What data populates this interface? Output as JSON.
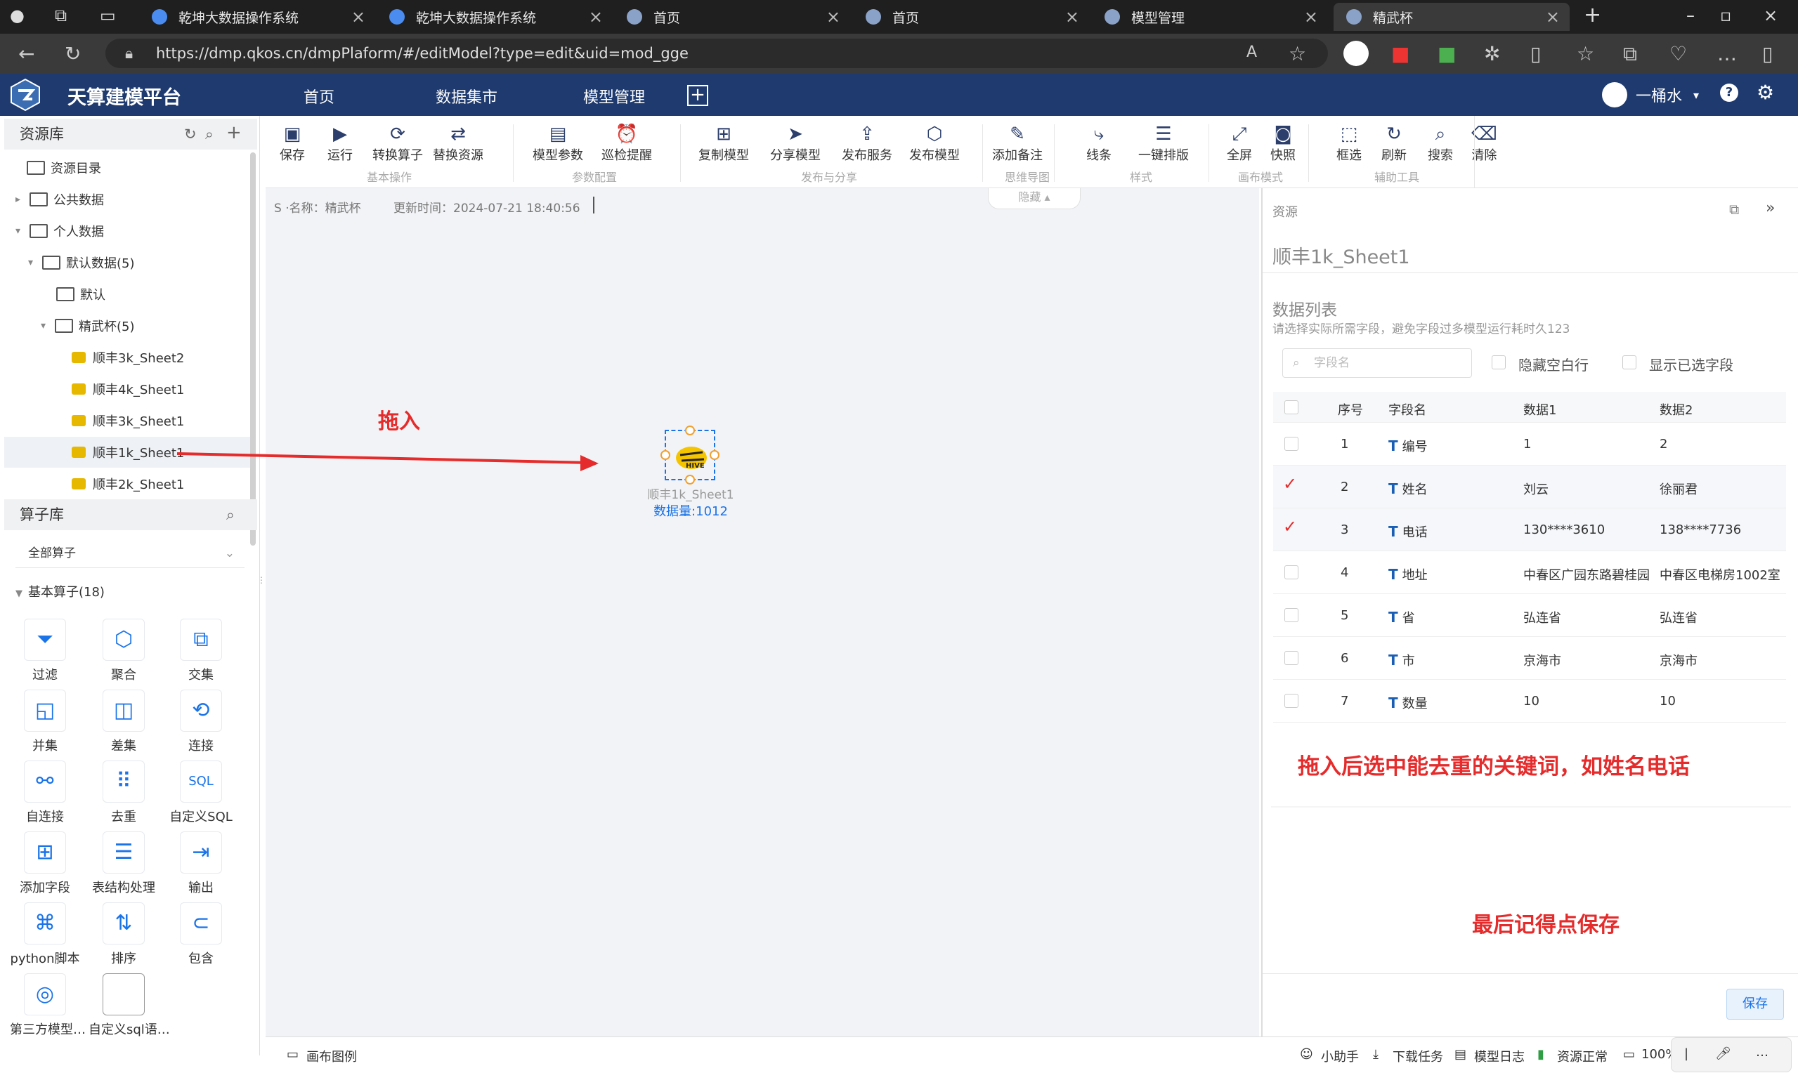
{
  "browser": {
    "tabs": [
      {
        "title": "乾坤大数据操作系统"
      },
      {
        "title": "乾坤大数据操作系统"
      },
      {
        "title": "首页"
      },
      {
        "title": "首页"
      },
      {
        "title": "模型管理"
      },
      {
        "title": "精武杯"
      }
    ],
    "url": "https://dmp.qkos.cn/dmpPlaform/#/editModel?type=edit&uid=mod_gge"
  },
  "app": {
    "name": "天算建模平台",
    "nav": [
      "首页",
      "数据集市",
      "模型管理"
    ],
    "user": "一桶水"
  },
  "left": {
    "resource_title": "资源库",
    "tree": [
      {
        "label": "资源目录",
        "type": "folder"
      },
      {
        "label": "公共数据",
        "type": "folder"
      },
      {
        "label": "个人数据",
        "type": "folder"
      },
      {
        "label": "默认数据(5)",
        "type": "folder"
      },
      {
        "label": "默认",
        "type": "folder"
      },
      {
        "label": "精武杯(5)",
        "type": "folder"
      },
      {
        "label": "顺丰3k_Sheet2",
        "type": "hive"
      },
      {
        "label": "顺丰4k_Sheet1",
        "type": "hive"
      },
      {
        "label": "顺丰3k_Sheet1",
        "type": "hive"
      },
      {
        "label": "顺丰1k_Sheet1",
        "type": "hive"
      },
      {
        "label": "顺丰2k_Sheet1",
        "type": "hive"
      }
    ],
    "operator_title": "算子库",
    "operator_filter": "全部算子",
    "basic_group": "基本算子(18)",
    "operators": [
      "过滤",
      "聚合",
      "交集",
      "并集",
      "差集",
      "连接",
      "自连接",
      "去重",
      "自定义SQL",
      "添加字段",
      "表结构处理",
      "输出",
      "python脚本",
      "排序",
      "包含",
      "第三方模型…",
      "自定义sql语…"
    ]
  },
  "toolbar": {
    "groups": [
      {
        "name": "基本操作",
        "items": [
          "保存",
          "运行",
          "转换算子",
          "替换资源"
        ]
      },
      {
        "name": "参数配置",
        "items": [
          "模型参数",
          "巡检提醒"
        ]
      },
      {
        "name": "发布与分享",
        "items": [
          "复制模型",
          "分享模型",
          "发布服务",
          "发布模型"
        ]
      },
      {
        "name": "思维导图",
        "items": [
          "添加备注"
        ]
      },
      {
        "name": "样式",
        "items": [
          "线条",
          "一键排版"
        ]
      },
      {
        "name": "画布模式",
        "items": [
          "全屏",
          "快照"
        ]
      },
      {
        "name": "辅助工具",
        "items": [
          "框选",
          "刷新",
          "搜索",
          "清除"
        ]
      }
    ],
    "hide_label": "隐藏"
  },
  "canvas": {
    "meta_name": "S ·名称：精武杯",
    "meta_time": "更新时间：2024-07-21 18:40:56",
    "node_name": "顺丰1k_Sheet1",
    "node_count": "数据量:1012",
    "legend_label": "画布图例"
  },
  "annotations": {
    "drag": "拖入",
    "select_tip": "拖入后选中能去重的关键词，如姓名电话",
    "save_tip": "最后记得点保存"
  },
  "right": {
    "panel_title": "资源",
    "resource_name": "顺丰1k_Sheet1",
    "list_title": "数据列表",
    "list_hint": "请选择实际所需字段，避免字段过多模型运行耗时久123",
    "search_placeholder": "字段名",
    "hide_empty": "隐藏空白行",
    "show_selected": "显示已选字段",
    "columns": [
      "序号",
      "字段名",
      "数据1",
      "数据2"
    ],
    "rows": [
      {
        "no": "1",
        "field": "编号",
        "d1": "1",
        "d2": "2",
        "checked": false
      },
      {
        "no": "2",
        "field": "姓名",
        "d1": "刘云",
        "d2": "徐丽君",
        "checked": true
      },
      {
        "no": "3",
        "field": "电话",
        "d1": "130****3610",
        "d2": "138****7736",
        "checked": true
      },
      {
        "no": "4",
        "field": "地址",
        "d1": "中春区广园东路碧桂园",
        "d2": "中春区电梯房1002室",
        "checked": false
      },
      {
        "no": "5",
        "field": "省",
        "d1": "弘连省",
        "d2": "弘连省",
        "checked": false
      },
      {
        "no": "6",
        "field": "市",
        "d1": "京海市",
        "d2": "京海市",
        "checked": false
      },
      {
        "no": "7",
        "field": "数量",
        "d1": "10",
        "d2": "10",
        "checked": false
      }
    ],
    "field_type_glyph": "T",
    "save_label": "保存"
  },
  "status": {
    "items": [
      "小助手",
      "下载任务",
      "模型日志",
      "资源正常"
    ],
    "zoom": "100%"
  },
  "colors": {
    "header": "#1e3a6e",
    "accent": "#1a73e8",
    "annotation": "#e52b2b"
  }
}
